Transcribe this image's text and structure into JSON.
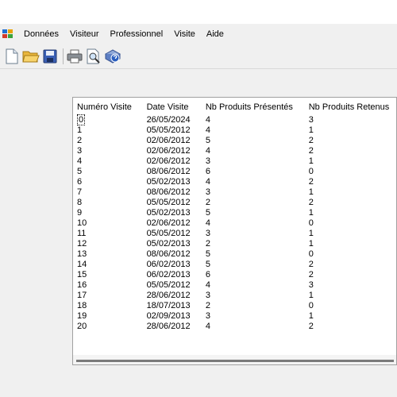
{
  "menu": {
    "items": [
      {
        "label": "Données",
        "name": "menu-donnees"
      },
      {
        "label": "Visiteur",
        "name": "menu-visiteur"
      },
      {
        "label": "Professionnel",
        "name": "menu-professionnel"
      },
      {
        "label": "Visite",
        "name": "menu-visite"
      },
      {
        "label": "Aide",
        "name": "menu-aide"
      }
    ]
  },
  "toolbar": {
    "icons": [
      "new-document-icon",
      "open-folder-icon",
      "save-icon",
      "print-icon",
      "print-preview-icon",
      "help-icon"
    ]
  },
  "grid": {
    "columns": [
      "Numéro Visite",
      "Date Visite",
      "Nb Produits Présentés",
      "Nb Produits Retenus"
    ],
    "rows": [
      [
        "0",
        "26/05/2024",
        "4",
        "3"
      ],
      [
        "1",
        "05/05/2012",
        "4",
        "1"
      ],
      [
        "2",
        "02/06/2012",
        "5",
        "2"
      ],
      [
        "3",
        "02/06/2012",
        "4",
        "2"
      ],
      [
        "4",
        "02/06/2012",
        "3",
        "1"
      ],
      [
        "5",
        "08/06/2012",
        "6",
        "0"
      ],
      [
        "6",
        "05/02/2013",
        "4",
        "2"
      ],
      [
        "7",
        "08/06/2012",
        "3",
        "1"
      ],
      [
        "8",
        "05/05/2012",
        "2",
        "2"
      ],
      [
        "9",
        "05/02/2013",
        "5",
        "1"
      ],
      [
        "10",
        "02/06/2012",
        "4",
        "0"
      ],
      [
        "11",
        "05/05/2012",
        "3",
        "1"
      ],
      [
        "12",
        "05/02/2013",
        "2",
        "1"
      ],
      [
        "13",
        "08/06/2012",
        "5",
        "0"
      ],
      [
        "14",
        "06/02/2013",
        "5",
        "2"
      ],
      [
        "15",
        "06/02/2013",
        "6",
        "2"
      ],
      [
        "16",
        "05/05/2012",
        "4",
        "3"
      ],
      [
        "17",
        "28/06/2012",
        "3",
        "1"
      ],
      [
        "18",
        "18/07/2013",
        "2",
        "0"
      ],
      [
        "19",
        "02/09/2013",
        "3",
        "1"
      ],
      [
        "20",
        "28/06/2012",
        "4",
        "2"
      ]
    ]
  }
}
